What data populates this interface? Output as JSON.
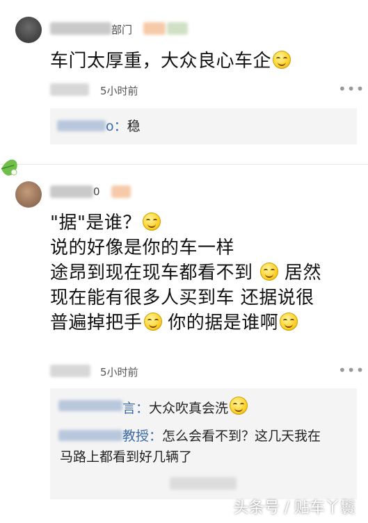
{
  "comment1": {
    "user_suffix": "部门",
    "text": "车门太厚重，大众良心车企",
    "time": "5小时前",
    "more": "•••",
    "replies": [
      {
        "name": "o：",
        "text": "稳"
      }
    ]
  },
  "comment2": {
    "user_suffix": "0",
    "lines": [
      "\"据\"是谁？",
      "说的好像是你的车一样",
      "途昂到现在现车都看不到",
      "居然",
      "现在能有很多人买到车 还据说很",
      "普遍掉把手",
      "你的据是谁啊"
    ],
    "time": "5小时前",
    "more": "•••",
    "replies": [
      {
        "name": "言：",
        "text": "大众吹真会洗"
      },
      {
        "name": "教授：",
        "text": "怎么会看不到？这几天我在",
        "text2": "马路上都看到好几辆了"
      }
    ]
  },
  "watermark": "头条号 / 贴车丫鬟"
}
